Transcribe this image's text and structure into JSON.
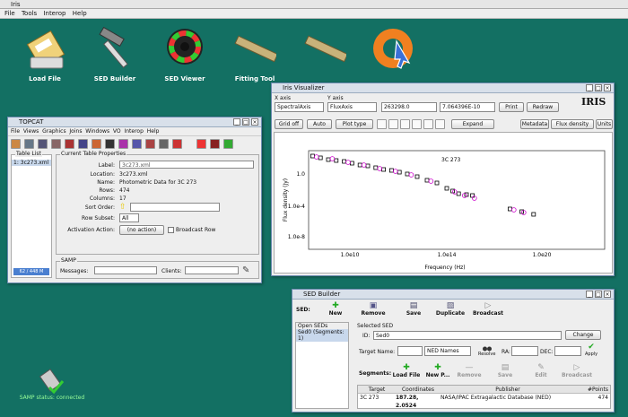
{
  "app": {
    "title": "Iris",
    "menu": [
      "File",
      "Tools",
      "Interop",
      "Help"
    ]
  },
  "desktop_icons": [
    {
      "label": "Load File",
      "icon": "floppy-disk-icon"
    },
    {
      "label": "SED Builder",
      "icon": "hammer-icon"
    },
    {
      "label": "SED Viewer",
      "icon": "color-wheel-icon"
    },
    {
      "label": "Fitting Tool",
      "icon": "ruler-icon"
    },
    {
      "label": "",
      "icon": "ruler-icon"
    },
    {
      "label": "",
      "icon": "lifebuoy-icon"
    }
  ],
  "samp_status": "SAMP status: connected",
  "visualizer": {
    "title": "Iris Visualizer",
    "x_axis_label": "X axis",
    "y_axis_label": "Y axis",
    "x_axis_value": "SpectralAxis",
    "y_axis_value": "FluxAxis",
    "x_coord": "263298.0",
    "y_coord": "7.064396E-10",
    "print": "Print",
    "redraw": "Redraw",
    "grid": "Grid off",
    "auto": "Auto",
    "plot_type": "Plot type",
    "expand": "Expand",
    "metadata": "Metadata",
    "flux_density": "Flux density",
    "units": "Units",
    "logo": "IRIS",
    "plot": {
      "label": "3C 273",
      "xlabel": "Frequency (Hz)",
      "ylabel": "Flux density (Jy)",
      "xticks": [
        "1.0e10",
        "1.0e14",
        "1.0e20"
      ],
      "yticks": [
        "1.0",
        "1.0e-4",
        "1.0e-8"
      ]
    }
  },
  "chart_data": {
    "type": "scatter",
    "title": "3C 273",
    "xlabel": "Frequency (Hz)",
    "ylabel": "Flux density (Jy)",
    "log_x": true,
    "log_y": true,
    "xlim_log10": [
      7,
      22
    ],
    "ylim_log10": [
      -9,
      2
    ],
    "series": [
      {
        "name": "",
        "color": "#000000",
        "x_log10": [
          7.2,
          7.6,
          8.0,
          8.4,
          8.8,
          9.2,
          9.6,
          10.0,
          10.4,
          10.8,
          11.2,
          11.6,
          12.0,
          12.5,
          13.0,
          13.5,
          14.0,
          14.3,
          14.6,
          15.0,
          15.3,
          17.2,
          17.8,
          18.4
        ],
        "y_log10": [
          1.4,
          1.2,
          1.0,
          0.9,
          0.8,
          0.6,
          0.4,
          0.3,
          0.1,
          -0.1,
          -0.2,
          -0.4,
          -0.6,
          -0.9,
          -1.3,
          -1.6,
          -2.2,
          -2.5,
          -2.8,
          -2.9,
          -3.0,
          -4.5,
          -4.8,
          -5.1
        ]
      },
      {
        "name": "",
        "color": "#cc00cc",
        "x_log10": [
          7.4,
          8.2,
          9.0,
          9.8,
          10.6,
          11.4,
          12.2,
          13.2,
          14.4,
          14.9,
          15.4,
          17.4,
          17.9
        ],
        "y_log10": [
          1.3,
          1.1,
          0.7,
          0.4,
          0.0,
          -0.3,
          -0.7,
          -1.4,
          -2.6,
          -3.0,
          -3.3,
          -4.6,
          -4.9
        ]
      }
    ]
  },
  "topcat": {
    "title": "TOPCAT",
    "menu": [
      "File",
      "Views",
      "Graphics",
      "Joins",
      "Windows",
      "VO",
      "Interop",
      "Help"
    ],
    "table_list_title": "Table List",
    "table_item": "1: 3c273.xml",
    "memory": "62 / 448 M",
    "props_title": "Current Table Properties",
    "label_k": "Label:",
    "label_v": "3c273.xml",
    "location_k": "Location:",
    "location_v": "3c273.xml",
    "name_k": "Name:",
    "name_v": "Photometric Data for 3C 273",
    "rows_k": "Rows:",
    "rows_v": "474",
    "columns_k": "Columns:",
    "columns_v": "17",
    "sort_k": "Sort Order:",
    "subset_k": "Row Subset:",
    "subset_v": "All",
    "activation_k": "Activation Action:",
    "activation_v": "(no action)",
    "broadcast": "Broadcast Row",
    "samp_title": "SAMP",
    "messages": "Messages:",
    "clients": "Clients:"
  },
  "sed_builder": {
    "title": "SED Builder",
    "sed_label": "SED:",
    "buttons": [
      "New",
      "Remove",
      "Save",
      "Duplicate",
      "Broadcast"
    ],
    "open_seds": "Open SEDs",
    "open_item": "Sed0 (Segments: 1)",
    "selected": "Selected SED",
    "id_k": "ID:",
    "id_v": "Sed0",
    "change": "Change",
    "target_k": "Target Name:",
    "ned": "NED Names",
    "resolve": "Resolve",
    "ra_k": "RA:",
    "dec_k": "DEC:",
    "apply": "Apply",
    "segments_k": "Segments:",
    "seg_buttons": [
      "Load File",
      "New P...",
      "Remove",
      "Save",
      "Edit",
      "Broadcast"
    ],
    "columns": [
      "Target",
      "Coordinates",
      "Publisher",
      "#Points"
    ],
    "row": [
      "3C 273",
      "187.28, 2.0524",
      "NASA/IPAC Extragalactic Database (NED)",
      "474"
    ]
  }
}
